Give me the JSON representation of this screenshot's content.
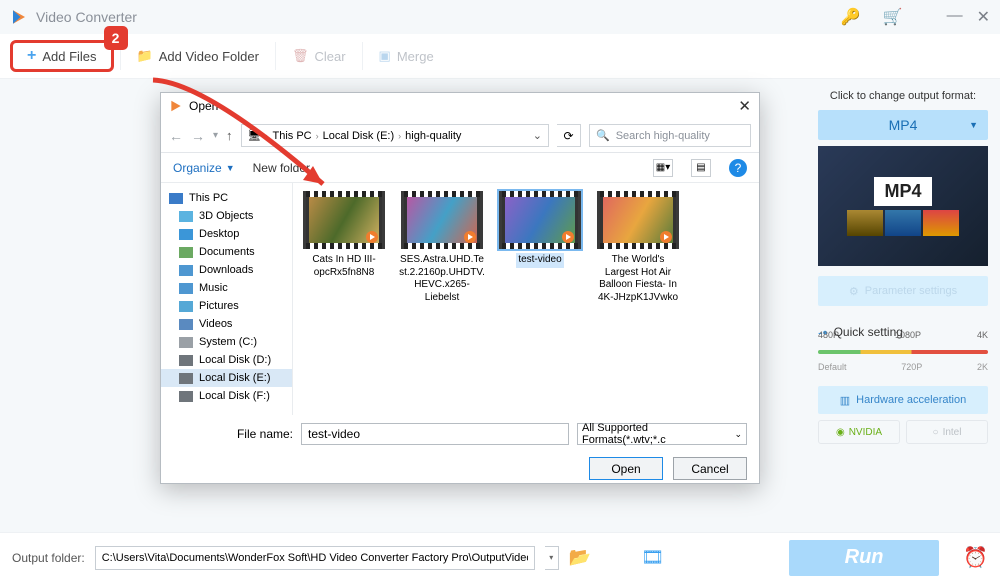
{
  "app": {
    "title": "Video Converter"
  },
  "toolbar": {
    "add_files": "Add Files",
    "badge": "2",
    "add_folder": "Add Video Folder",
    "clear": "Clear",
    "merge": "Merge"
  },
  "dialog": {
    "title": "Open",
    "crumbs": [
      "This PC",
      "Local Disk (E:)",
      "high-quality"
    ],
    "search_placeholder": "Search high-quality",
    "organize": "Organize",
    "new_folder": "New folder",
    "tree": {
      "root": "This PC",
      "items": [
        "3D Objects",
        "Desktop",
        "Documents",
        "Downloads",
        "Music",
        "Pictures",
        "Videos",
        "System (C:)",
        "Local Disk (D:)",
        "Local Disk (E:)",
        "Local Disk (F:)"
      ],
      "selected_index": 9
    },
    "files": [
      {
        "name": "Cats In HD III-opcRx5fn8N8"
      },
      {
        "name": "SES.Astra.UHD.Test.2.2160p.UHDTV.HEVC.x265-Liebelst"
      },
      {
        "name": "test-video",
        "selected": true
      },
      {
        "name": "The World's Largest Hot Air Balloon Fiesta- In 4K-JHzpK1JVwko"
      }
    ],
    "filename_label": "File name:",
    "filename_value": "test-video",
    "filetype": "All Supported Formats(*.wtv;*.c",
    "open": "Open",
    "cancel": "Cancel"
  },
  "right": {
    "heading": "Click to change output format:",
    "format": "MP4",
    "thumb_badge": "MP4",
    "param": "Parameter settings",
    "quick": "Quick setting",
    "res_top": [
      "480P",
      "1080P",
      "4K"
    ],
    "res_bottom": [
      "Default",
      "720P",
      "2K"
    ],
    "hw": "Hardware acceleration",
    "nvidia": "NVIDIA",
    "intel": "Intel"
  },
  "bottom": {
    "label": "Output folder:",
    "path": "C:\\Users\\Vita\\Documents\\WonderFox Soft\\HD Video Converter Factory Pro\\OutputVideo\\",
    "run": "Run"
  }
}
